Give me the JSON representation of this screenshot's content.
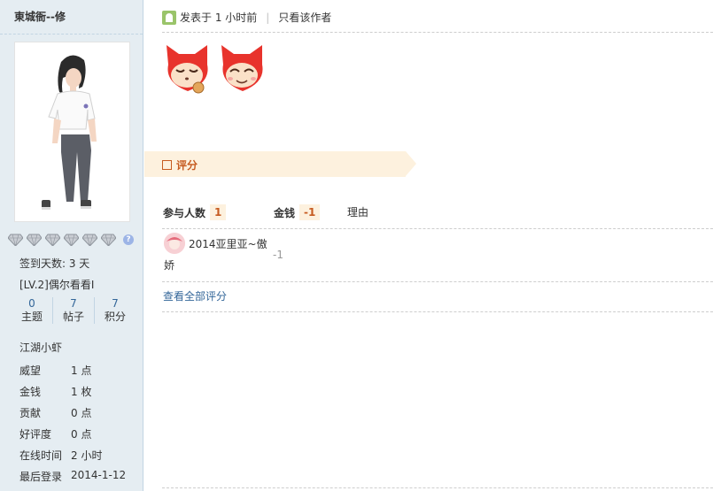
{
  "user": {
    "name": "東城衙--修",
    "signin_days": "签到天数: 3 天",
    "level": "[LV.2]偶尔看看I",
    "stats": [
      {
        "num": "0",
        "label": "主题"
      },
      {
        "num": "7",
        "label": "帖子"
      },
      {
        "num": "7",
        "label": "积分"
      }
    ],
    "rank": "江湖小虾",
    "profile": [
      {
        "key": "威望",
        "val": "1 点"
      },
      {
        "key": "金钱",
        "val": "1 枚"
      },
      {
        "key": "贡献",
        "val": "0 点"
      },
      {
        "key": "好评度",
        "val": "0 点"
      },
      {
        "key": "在线时间",
        "val": "2 小时"
      },
      {
        "key": "最后登录",
        "val": "2014-1-12"
      }
    ],
    "help_glyph": "?"
  },
  "post": {
    "posted": "发表于 1 小时前",
    "separator": "|",
    "only_author": "只看该作者"
  },
  "rating": {
    "title": "评分",
    "participants_label": "参与人数",
    "participants_value": "1",
    "money_label": "金钱",
    "money_value": "-1",
    "reason_label": "理由",
    "rater_name_line1": "2014亚里亚~傲",
    "rater_name_line2": "娇",
    "rater_value": "-1",
    "view_all": "查看全部评分"
  },
  "colors": {
    "sidebar_bg": "#E5EDF2",
    "accent": "#C65B20",
    "band": "#FDF1DE",
    "link": "#336699"
  }
}
